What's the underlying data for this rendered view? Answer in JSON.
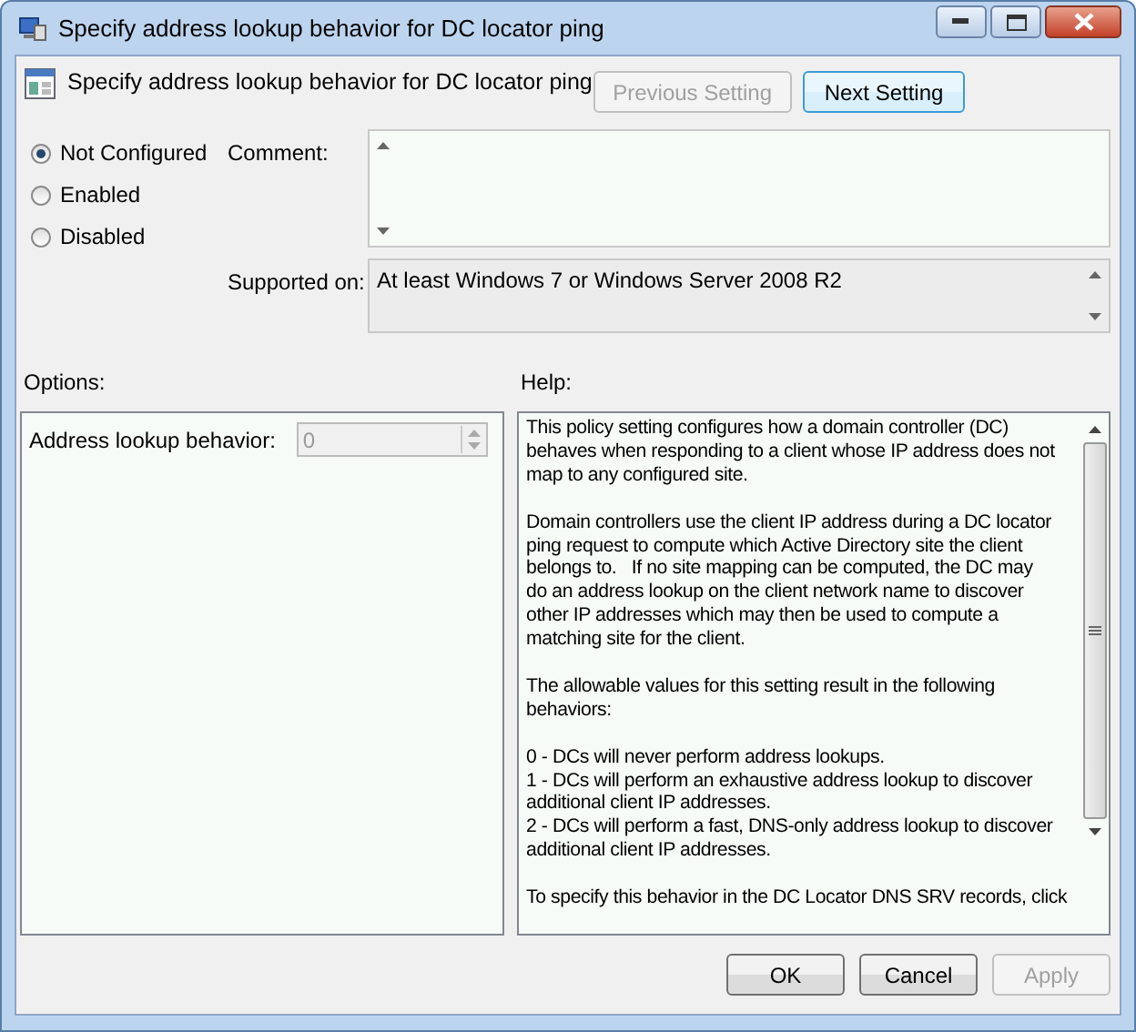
{
  "window": {
    "title": "Specify address lookup behavior for DC locator ping"
  },
  "header": {
    "title": "Specify address lookup behavior for DC locator ping",
    "buttons": [
      {
        "label": "Previous Setting",
        "disabled": true,
        "default": false
      },
      {
        "label": "Next Setting",
        "disabled": false,
        "default": true
      }
    ]
  },
  "state_options": [
    {
      "label": "Not Configured",
      "selected": true
    },
    {
      "label": "Enabled",
      "selected": false
    },
    {
      "label": "Disabled",
      "selected": false
    }
  ],
  "comment": {
    "label": "Comment:"
  },
  "supported_on": {
    "label": "Supported on:",
    "value": "At least Windows 7 or Windows Server 2008 R2"
  },
  "options": {
    "label": "Options:",
    "fields": [
      {
        "label": "Address lookup behavior:",
        "value": "0",
        "disabled": true
      }
    ]
  },
  "help": {
    "label": "Help:",
    "paragraphs": [
      [
        "This policy setting configures how a domain controller (DC)",
        "behaves when responding to a client whose IP address does not",
        "map to any configured site."
      ],
      [
        "Domain controllers use the client IP address during a DC locator",
        "ping request to compute which Active Directory site the client",
        "belongs to.   If no site mapping can be computed, the DC may",
        "do an address lookup on the client network name to discover",
        "other IP addresses which may then be used to compute a",
        "matching site for the client."
      ],
      [
        "The allowable values for this setting result in the following",
        "behaviors:"
      ],
      [
        "0 - DCs will never perform address lookups.",
        "1 - DCs will perform an exhaustive address lookup to discover",
        "additional client IP addresses.",
        "2 - DCs will perform a fast, DNS-only address lookup to discover",
        "additional client IP addresses."
      ],
      [
        "To specify this behavior in the DC Locator DNS SRV records, click"
      ]
    ]
  },
  "footer_buttons": [
    {
      "label": "OK",
      "disabled": false
    },
    {
      "label": "Cancel",
      "disabled": false
    },
    {
      "label": "Apply",
      "disabled": true
    }
  ]
}
